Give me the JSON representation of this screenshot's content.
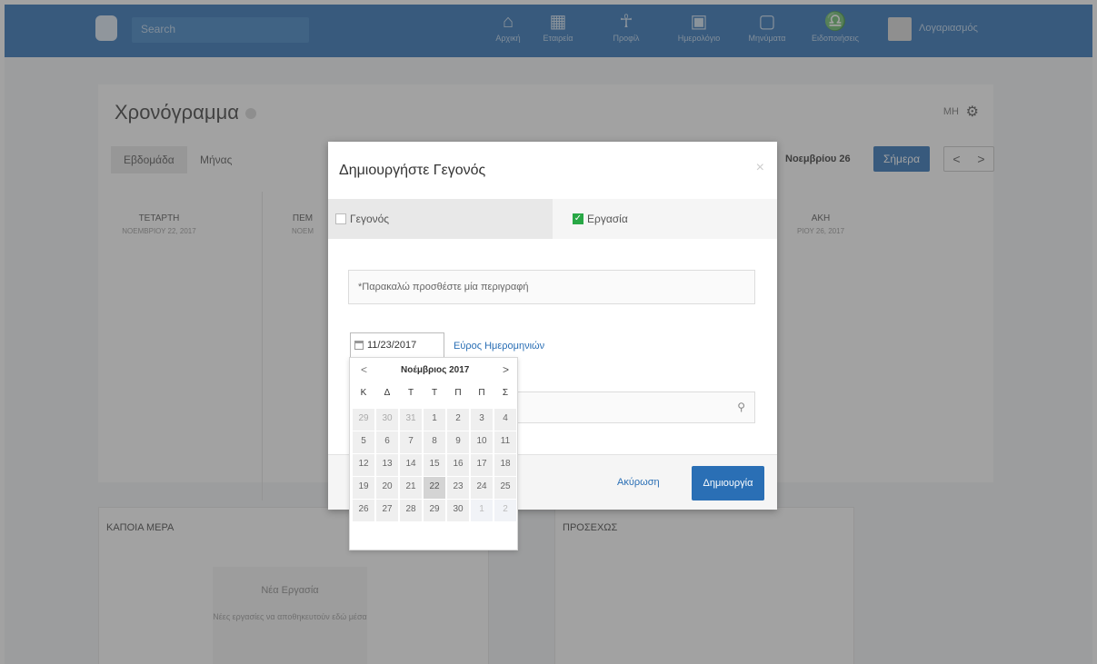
{
  "header": {
    "search_placeholder": "Search",
    "nav": [
      {
        "label": "Αρχική",
        "icon": "home-icon",
        "glyph": "⌂"
      },
      {
        "label": "Εταιρεία",
        "icon": "building-icon",
        "glyph": "▦"
      },
      {
        "label": "Προφίλ",
        "icon": "person-icon",
        "glyph": "☥"
      },
      {
        "label": "Ημερολόγιο",
        "icon": "calendar-icon",
        "glyph": "▣"
      },
      {
        "label": "Μηνύματα",
        "icon": "chat-icon",
        "glyph": "▢"
      },
      {
        "label": "Ειδοποιήσεις",
        "icon": "bell-icon",
        "glyph": "♎"
      }
    ],
    "username": "Λογαριασμός"
  },
  "page": {
    "title": "Χρονόγραμμα",
    "view_tabs": [
      "Εβδομάδα",
      "Μήνας"
    ],
    "date_range": "Νοεμβρίου 26",
    "today_label": "Σήμερα",
    "prev": "<",
    "next": ">",
    "right_option": "ΜΗ",
    "day_headers": [
      {
        "name": "ΤΕΤΑΡΤΗ",
        "date": "ΝΟΕΜΒΡΙΟΥ 22, 2017"
      },
      {
        "name": "ΠΕΜ",
        "date": "ΝΟΕΜ"
      },
      {
        "name": "ΑΚΗ",
        "date": "ΡΙΟΥ 26, 2017"
      }
    ],
    "panel_someday": {
      "title": "ΚΑΠΟΙΑ ΜΕΡΑ",
      "empty_title": "Νέα Εργασία",
      "empty_text": "Νέες εργασίες να αποθηκευτούν εδώ μέσα"
    },
    "panel_upcoming": {
      "title": "ΠΡΟΣΕΧΩΣ"
    }
  },
  "modal": {
    "title": "Δημιουργήστε Γεγονός",
    "close": "×",
    "tab_event": "Γεγονός",
    "tab_task": "Εργασία",
    "description_placeholder": "*Παρακαλώ προσθέστε μία περιγραφή",
    "date_value": "11/23/2017",
    "range_link": "Εύρος Ημερομηνιών",
    "cancel_label": "Ακύρωση",
    "create_label": "Δημιουργία"
  },
  "datepicker": {
    "month_label": "Νοέμβριος 2017",
    "prev": "<",
    "next": ">",
    "weekdays": [
      "Κ",
      "Δ",
      "Τ",
      "Τ",
      "Π",
      "Π",
      "Σ"
    ],
    "weeks": [
      [
        "29",
        "30",
        "31",
        "1",
        "2",
        "3",
        "4"
      ],
      [
        "5",
        "6",
        "7",
        "8",
        "9",
        "10",
        "11"
      ],
      [
        "12",
        "13",
        "14",
        "15",
        "16",
        "17",
        "18"
      ],
      [
        "19",
        "20",
        "21",
        "22",
        "23",
        "24",
        "25"
      ],
      [
        "26",
        "27",
        "28",
        "29",
        "30",
        "1",
        "2"
      ]
    ],
    "today": "22"
  },
  "colors": {
    "brand_blue": "#2a6fb5",
    "success_green": "#28a745"
  }
}
